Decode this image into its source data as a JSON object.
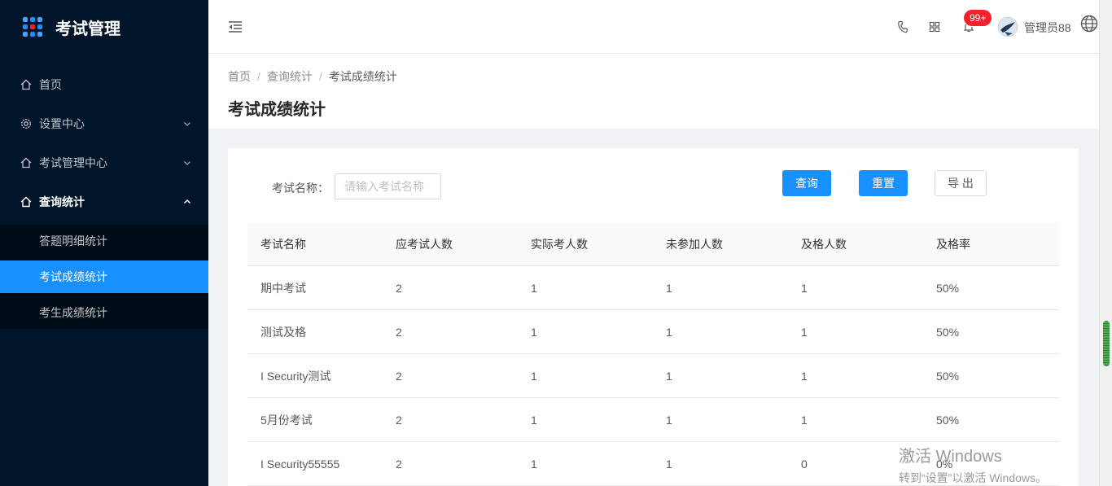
{
  "app": {
    "title": "考试管理"
  },
  "sidebar": {
    "items": [
      {
        "label": "首页"
      },
      {
        "label": "设置中心"
      },
      {
        "label": "考试管理中心"
      },
      {
        "label": "查询统计"
      }
    ],
    "sub_items": [
      {
        "label": "答题明细统计"
      },
      {
        "label": "考试成绩统计"
      },
      {
        "label": "考生成绩统计"
      }
    ],
    "active_item": "考试成绩统计"
  },
  "header": {
    "notification_badge": "99+",
    "username": "管理员88",
    "icons": [
      "menu-fold-icon",
      "phone-icon",
      "apps-icon",
      "bell-icon",
      "globe-icon"
    ]
  },
  "breadcrumb": {
    "items": [
      "首页",
      "查询统计",
      "考试成绩统计"
    ]
  },
  "page": {
    "title": "考试成绩统计"
  },
  "search": {
    "label": "考试名称：",
    "placeholder": "请输入考试名称",
    "value": "",
    "query_label": "查询",
    "reset_label": "重置",
    "export_label": "导 出"
  },
  "table": {
    "columns": [
      "考试名称",
      "应考试人数",
      "实际考人数",
      "未参加人数",
      "及格人数",
      "及格率"
    ],
    "rows": [
      [
        "期中考试",
        "2",
        "1",
        "1",
        "1",
        "50%"
      ],
      [
        "测试及格",
        "2",
        "1",
        "1",
        "1",
        "50%"
      ],
      [
        "I Security测试",
        "2",
        "1",
        "1",
        "1",
        "50%"
      ],
      [
        "5月份考试",
        "2",
        "1",
        "1",
        "1",
        "50%"
      ],
      [
        "I Security55555",
        "2",
        "1",
        "1",
        "0",
        "0%"
      ]
    ]
  },
  "watermark": {
    "line1": "激活 Windows",
    "line2": "转到“设置”以激活 Windows。"
  },
  "colors": {
    "sidebar_bg": "#001529",
    "primary": "#1890ff",
    "badge": "#f5222d"
  }
}
